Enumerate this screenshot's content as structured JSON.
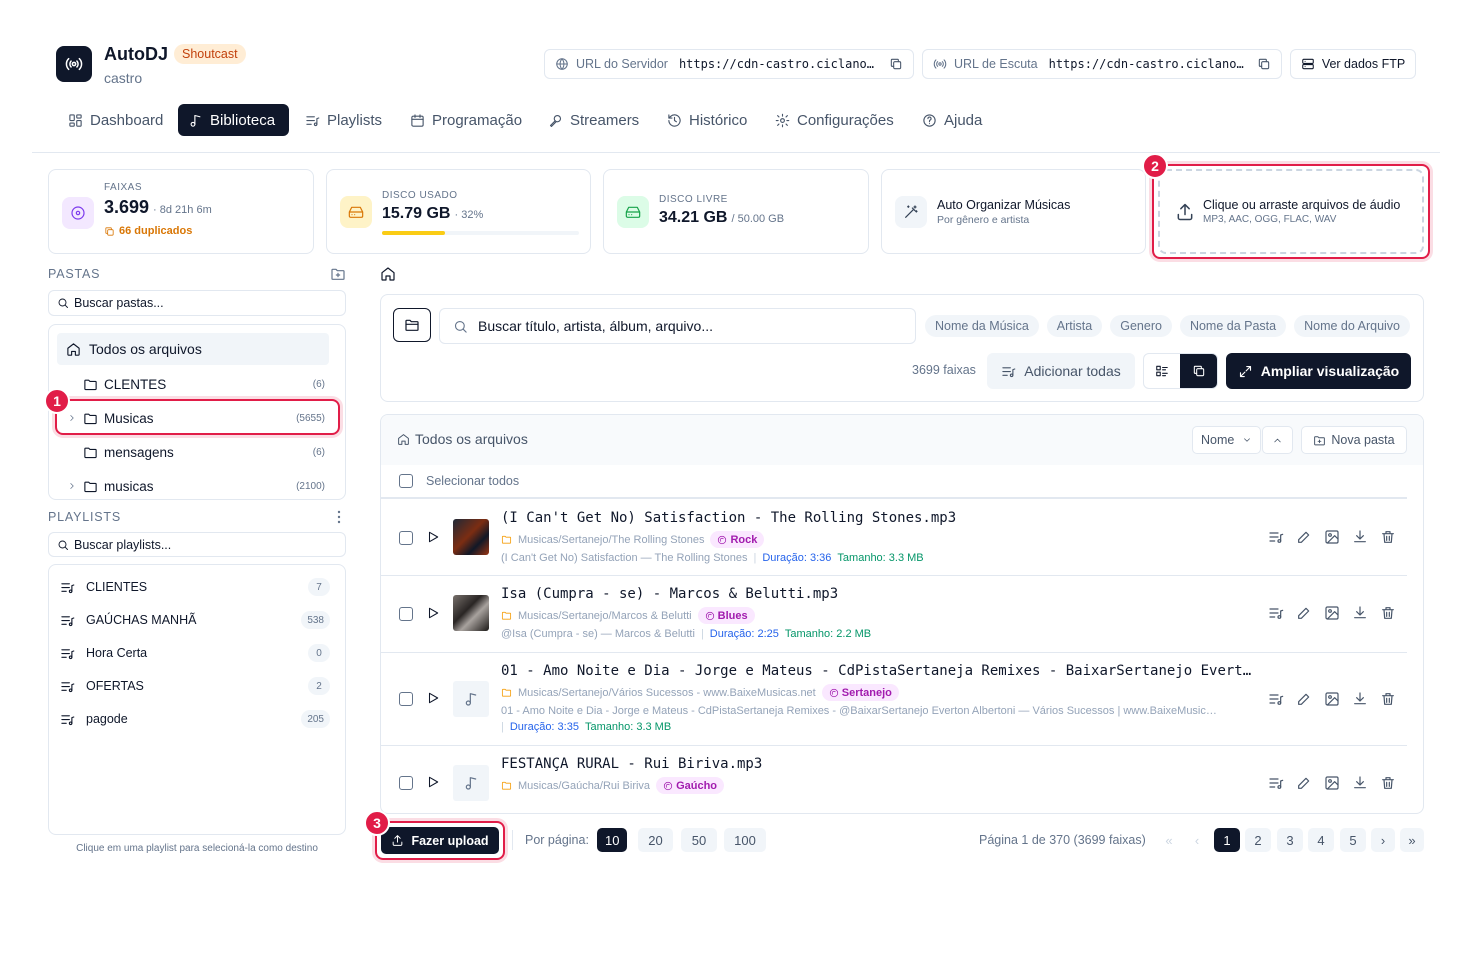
{
  "header": {
    "app_name": "AutoDJ",
    "server_badge": "Shoutcast",
    "account": "castro",
    "server_url_label": "URL do Servidor",
    "server_url_value": "https://cdn-castro.ciclano…",
    "listen_url_label": "URL de Escuta",
    "listen_url_value": "https://cdn-castro.ciclano…",
    "ftp_button": "Ver dados FTP"
  },
  "nav": {
    "items": [
      "Dashboard",
      "Biblioteca",
      "Playlists",
      "Programação",
      "Streamers",
      "Histórico",
      "Configurações",
      "Ajuda"
    ],
    "active": "Biblioteca"
  },
  "stats": {
    "tracks_label": "FAIXAS",
    "tracks_value": "3.699",
    "tracks_duration": "· 8d 21h 6m",
    "duplicates": "66 duplicados",
    "disk_used_label": "DISCO USADO",
    "disk_used_value": "15.79 GB",
    "disk_used_pct": "· 32%",
    "disk_used_fraction": 0.32,
    "disk_free_label": "DISCO LIVRE",
    "disk_free_value": "34.21 GB",
    "disk_free_total": "/ 50.00 GB",
    "auto_title": "Auto Organizar Músicas",
    "auto_sub": "Por gênero e artista",
    "upload_title": "Clique ou arraste arquivos de áudio",
    "upload_sub": "MP3, AAC, OGG, FLAC, WAV"
  },
  "folders": {
    "title": "PASTAS",
    "search_placeholder": "Buscar pastas...",
    "all_files": "Todos os arquivos",
    "items": [
      {
        "name": "CLENTES",
        "count": "(6)"
      },
      {
        "name": "Musicas",
        "count": "(5655)"
      },
      {
        "name": "mensagens",
        "count": "(6)"
      },
      {
        "name": "musicas",
        "count": "(2100)"
      }
    ]
  },
  "playlists": {
    "title": "PLAYLISTS",
    "search_placeholder": "Buscar playlists...",
    "items": [
      {
        "name": "CLIENTES",
        "count": "7"
      },
      {
        "name": "GAÚCHAS MANHÃ",
        "count": "538"
      },
      {
        "name": "Hora Certa",
        "count": "0"
      },
      {
        "name": "OFERTAS",
        "count": "2"
      },
      {
        "name": "pagode",
        "count": "205"
      }
    ],
    "hint": "Clique em uma playlist para selecioná-la como destino"
  },
  "toolbar": {
    "search_placeholder": "Buscar título, artista, álbum, arquivo...",
    "filters": [
      "Nome da Música",
      "Artista",
      "Genero",
      "Nome da Pasta",
      "Nome do Arquivo"
    ],
    "count": "3699 faixas",
    "add_all": "Adicionar todas",
    "expand": "Ampliar visualização"
  },
  "list": {
    "breadcrumb": "Todos os arquivos",
    "sort": "Nome",
    "new_folder": "Nova pasta",
    "select_all": "Selecionar todos",
    "tracks": [
      {
        "title": "(I Can't Get No) Satisfaction - The Rolling Stones.mp3",
        "path": "Musicas/Sertanejo/The Rolling Stones",
        "genre": "Rock",
        "meta": "(I Can't Get No) Satisfaction — The Rolling Stones",
        "duration": "Duração: 3:36",
        "size": "Tamanho: 3.3 MB"
      },
      {
        "title": "Isa (Cumpra - se) - Marcos & Belutti.mp3",
        "path": "Musicas/Sertanejo/Marcos & Belutti",
        "genre": "Blues",
        "meta": "@Isa (Cumpra - se) — Marcos & Belutti",
        "duration": "Duração: 2:25",
        "size": "Tamanho: 2.2 MB"
      },
      {
        "title": "01 - Amo Noite e Dia - Jorge e Mateus - CdPistaSertaneja Remixes - BaixarSertanejo Evert…",
        "path": "Musicas/Sertanejo/Vários Sucessos - www.BaixeMusicas.net",
        "genre": "Sertanejo",
        "meta": "01 - Amo Noite e Dia - Jorge e Mateus - CdPistaSertaneja Remixes - @BaixarSertanejo Everton Albertoni — Vários Sucessos | www.BaixeMusic…",
        "duration": "Duração: 3:35",
        "size": "Tamanho: 3.3 MB"
      },
      {
        "title": "FESTANÇA RURAL - Rui Biriva.mp3",
        "path": "Musicas/Gaúcha/Rui Biriva",
        "genre": "Gaúcho"
      }
    ]
  },
  "footer": {
    "upload_button": "Fazer upload",
    "per_page_label": "Por página:",
    "per_page_options": [
      "10",
      "20",
      "50",
      "100"
    ],
    "page_info": "Página 1 de 370 (3699 faixas)",
    "pages": [
      "1",
      "2",
      "3",
      "4",
      "5"
    ],
    "first": "«",
    "prev": "‹",
    "next": "›",
    "last": "»"
  },
  "annotations": [
    "1",
    "2",
    "3"
  ],
  "colors": {
    "primary": "#0f172a",
    "highlight": "#e11d48",
    "shoutcast_bg": "#ffedd5",
    "shoutcast_text": "#c2410c",
    "genre_pill": "#a21caf",
    "duration": "#2563eb",
    "size": "#059669",
    "disk_bar": "#facc15"
  }
}
